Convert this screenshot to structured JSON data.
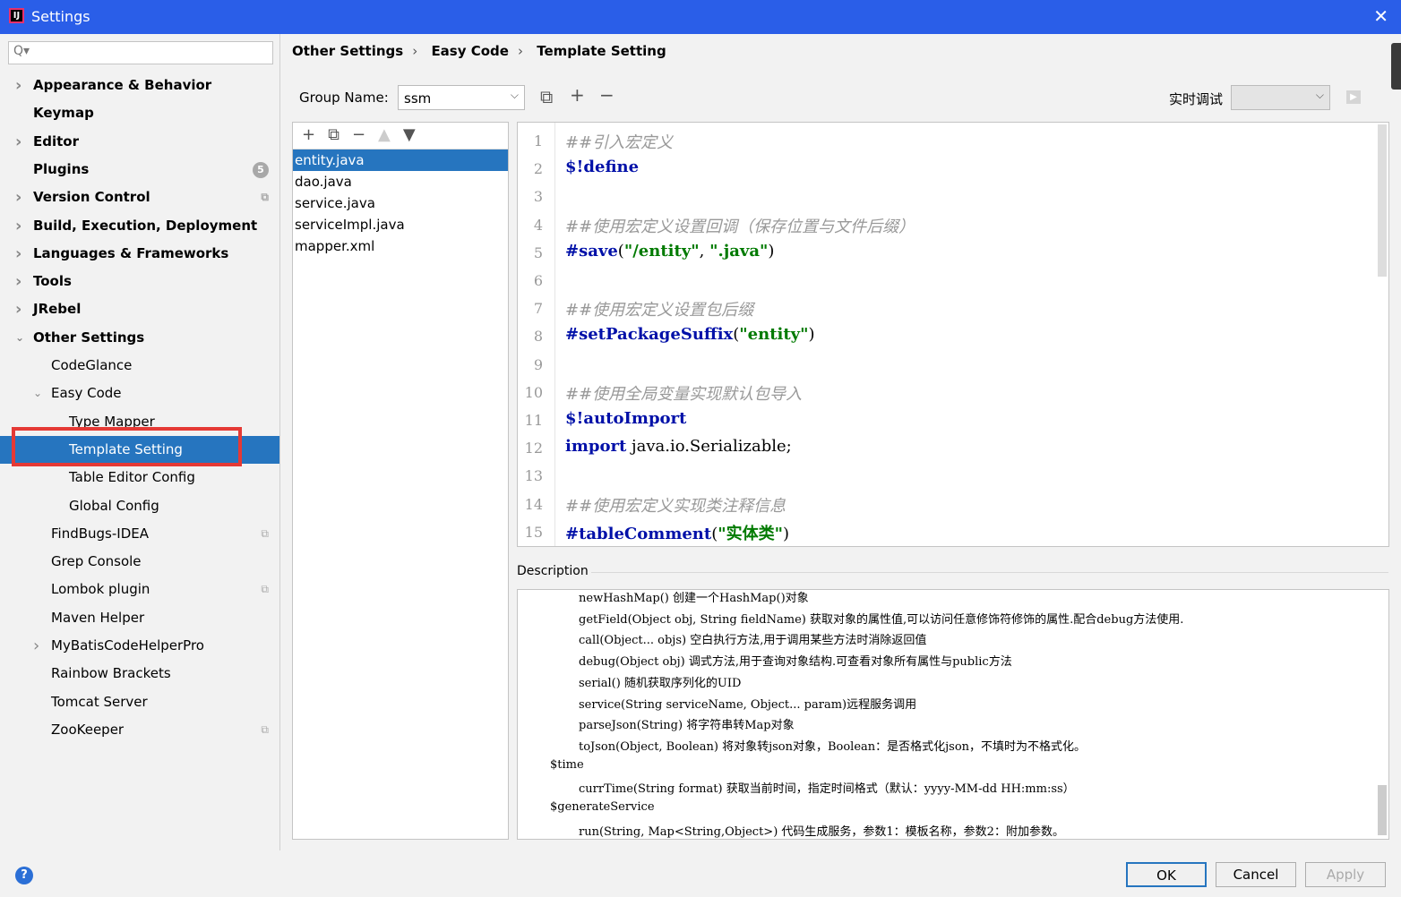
{
  "window": {
    "title": "Settings",
    "close_icon": "close-icon"
  },
  "search": {
    "placeholder": "Q▾"
  },
  "sidebar": {
    "items": [
      {
        "label": "Appearance & Behavior",
        "bold": true,
        "arrow": "right",
        "indent": 0
      },
      {
        "label": "Keymap",
        "bold": true,
        "indent": 0
      },
      {
        "label": "Editor",
        "bold": true,
        "arrow": "right",
        "indent": 0
      },
      {
        "label": "Plugins",
        "bold": true,
        "indent": 0,
        "badge": "5"
      },
      {
        "label": "Version Control",
        "bold": true,
        "arrow": "right",
        "indent": 0,
        "copy": true
      },
      {
        "label": "Build, Execution, Deployment",
        "bold": true,
        "arrow": "right",
        "indent": 0
      },
      {
        "label": "Languages & Frameworks",
        "bold": true,
        "arrow": "right",
        "indent": 0
      },
      {
        "label": "Tools",
        "bold": true,
        "arrow": "right",
        "indent": 0
      },
      {
        "label": "JRebel",
        "bold": true,
        "arrow": "right",
        "indent": 0
      },
      {
        "label": "Other Settings",
        "bold": true,
        "arrow": "down",
        "indent": 0
      },
      {
        "label": "CodeGlance",
        "indent": 1
      },
      {
        "label": "Easy Code",
        "arrow": "down",
        "indent": 1
      },
      {
        "label": "Type Mapper",
        "indent": 2
      },
      {
        "label": "Template Setting",
        "indent": 2,
        "selected": true
      },
      {
        "label": "Table Editor Config",
        "indent": 2
      },
      {
        "label": "Global Config",
        "indent": 2
      },
      {
        "label": "FindBugs-IDEA",
        "indent": 1,
        "copy": true
      },
      {
        "label": "Grep Console",
        "indent": 1
      },
      {
        "label": "Lombok plugin",
        "indent": 1,
        "copy": true
      },
      {
        "label": "Maven Helper",
        "indent": 1
      },
      {
        "label": "MyBatisCodeHelperPro",
        "arrow": "right",
        "indent": 1
      },
      {
        "label": "Rainbow Brackets",
        "indent": 1
      },
      {
        "label": "Tomcat Server",
        "indent": 1
      },
      {
        "label": "ZooKeeper",
        "indent": 1,
        "copy": true
      }
    ]
  },
  "breadcrumb": [
    "Other Settings",
    "Easy Code",
    "Template Setting"
  ],
  "group": {
    "label": "Group Name:",
    "value": "ssm"
  },
  "debug": {
    "label": "实时调试",
    "value": ""
  },
  "files": {
    "items": [
      "entity.java",
      "dao.java",
      "service.java",
      "serviceImpl.java",
      "mapper.xml"
    ],
    "selected": 0
  },
  "editor": {
    "lines": [
      [
        {
          "t": "##引入宏定义",
          "c": "comment"
        }
      ],
      [
        {
          "t": "$!define",
          "c": "kw"
        }
      ],
      [],
      [
        {
          "t": "##使用宏定义设置回调（保存位置与文件后缀）",
          "c": "comment"
        }
      ],
      [
        {
          "t": "#save",
          "c": "kw"
        },
        {
          "t": "(",
          "c": "plain"
        },
        {
          "t": "\"/entity\"",
          "c": "str"
        },
        {
          "t": ", ",
          "c": "plain"
        },
        {
          "t": "\".java\"",
          "c": "str"
        },
        {
          "t": ")",
          "c": "plain"
        }
      ],
      [],
      [
        {
          "t": "##使用宏定义设置包后缀",
          "c": "comment"
        }
      ],
      [
        {
          "t": "#setPackageSuffix",
          "c": "kw"
        },
        {
          "t": "(",
          "c": "plain"
        },
        {
          "t": "\"entity\"",
          "c": "str"
        },
        {
          "t": ")",
          "c": "plain"
        }
      ],
      [],
      [
        {
          "t": "##使用全局变量实现默认包导入",
          "c": "comment"
        }
      ],
      [
        {
          "t": "$!autoImport",
          "c": "kw"
        }
      ],
      [
        {
          "t": "import",
          "c": "kw"
        },
        {
          "t": " java.io.Serializable;",
          "c": "plain"
        }
      ],
      [],
      [
        {
          "t": "##使用宏定义实现类注释信息",
          "c": "comment"
        }
      ],
      [
        {
          "t": "#tableComment",
          "c": "kw"
        },
        {
          "t": "(",
          "c": "plain"
        },
        {
          "t": "\"实体类\"",
          "c": "str"
        },
        {
          "t": ")",
          "c": "plain"
        }
      ]
    ]
  },
  "description": {
    "label": "Description",
    "lines": [
      {
        "t": "newHashMap() 创建一个HashMap()对象",
        "indent": 1
      },
      {
        "t": "getField(Object obj, String fieldName) 获取对象的属性值,可以访问任意修饰符修饰的属性.配合debug方法使用.",
        "indent": 1
      },
      {
        "t": "call(Object... objs) 空白执行方法,用于调用某些方法时消除返回值",
        "indent": 1
      },
      {
        "t": "debug(Object obj) 调式方法,用于查询对象结构.可查看对象所有属性与public方法",
        "indent": 1
      },
      {
        "t": "serial() 随机获取序列化的UID",
        "indent": 1
      },
      {
        "t": "service(String serviceName, Object... param)远程服务调用",
        "indent": 1
      },
      {
        "t": "parseJson(String) 将字符串转Map对象",
        "indent": 1
      },
      {
        "t": "toJson(Object, Boolean) 将对象转json对象，Boolean：是否格式化json，不填时为不格式化。",
        "indent": 1
      },
      {
        "t": "$time",
        "indent": 0
      },
      {
        "t": "currTime(String format) 获取当前时间，指定时间格式（默认：yyyy-MM-dd HH:mm:ss）",
        "indent": 1
      },
      {
        "t": "$generateService",
        "indent": 0
      },
      {
        "t": "run(String, Map<String,Object>) 代码生成服务，参数1：模板名称，参数2：附加参数。",
        "indent": 1
      }
    ]
  },
  "buttons": {
    "ok": "OK",
    "cancel": "Cancel",
    "apply": "Apply",
    "help": "?"
  },
  "colors": {
    "titlebar": "#2a5ee8",
    "selection": "#2675bf",
    "highlight_box": "#e53935"
  }
}
